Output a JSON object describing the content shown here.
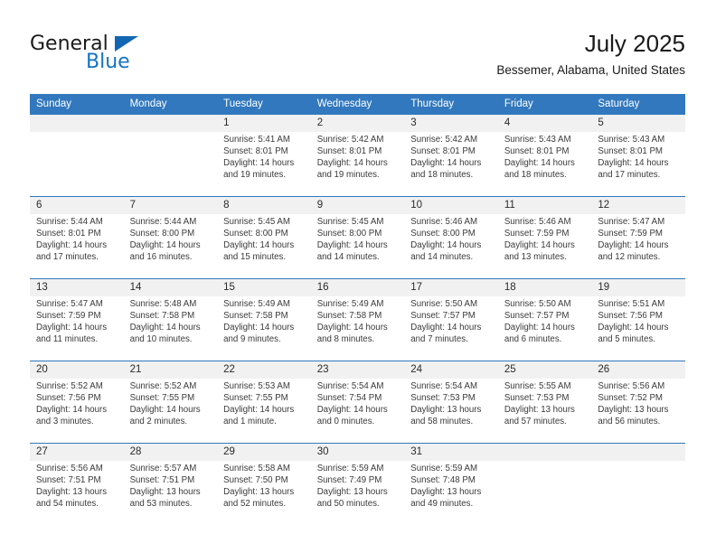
{
  "brand": {
    "name_part1": "General",
    "name_part2": "Blue",
    "triangle_icon": "triangle-icon",
    "accent_color": "#1573c6",
    "triangle_color": "#1267b2"
  },
  "header": {
    "title": "July 2025",
    "subtitle": "Bessemer, Alabama, United States"
  },
  "theme": {
    "header_bg": "#3278be",
    "header_text": "#ffffff",
    "daynum_bg": "#f1f1f1",
    "row_border": "#3278be",
    "body_text": "#3a3a3a"
  },
  "weekday_headers": [
    "Sunday",
    "Monday",
    "Tuesday",
    "Wednesday",
    "Thursday",
    "Friday",
    "Saturday"
  ],
  "labels": {
    "sunrise_prefix": "Sunrise:",
    "sunset_prefix": "Sunset:",
    "daylight_prefix": "Daylight:"
  },
  "weeks": [
    [
      {
        "day": "",
        "sunrise": "",
        "sunset": "",
        "daylight_line1": "",
        "daylight_line2": ""
      },
      {
        "day": "",
        "sunrise": "",
        "sunset": "",
        "daylight_line1": "",
        "daylight_line2": ""
      },
      {
        "day": "1",
        "sunrise": "Sunrise: 5:41 AM",
        "sunset": "Sunset: 8:01 PM",
        "daylight_line1": "Daylight: 14 hours",
        "daylight_line2": "and 19 minutes."
      },
      {
        "day": "2",
        "sunrise": "Sunrise: 5:42 AM",
        "sunset": "Sunset: 8:01 PM",
        "daylight_line1": "Daylight: 14 hours",
        "daylight_line2": "and 19 minutes."
      },
      {
        "day": "3",
        "sunrise": "Sunrise: 5:42 AM",
        "sunset": "Sunset: 8:01 PM",
        "daylight_line1": "Daylight: 14 hours",
        "daylight_line2": "and 18 minutes."
      },
      {
        "day": "4",
        "sunrise": "Sunrise: 5:43 AM",
        "sunset": "Sunset: 8:01 PM",
        "daylight_line1": "Daylight: 14 hours",
        "daylight_line2": "and 18 minutes."
      },
      {
        "day": "5",
        "sunrise": "Sunrise: 5:43 AM",
        "sunset": "Sunset: 8:01 PM",
        "daylight_line1": "Daylight: 14 hours",
        "daylight_line2": "and 17 minutes."
      }
    ],
    [
      {
        "day": "6",
        "sunrise": "Sunrise: 5:44 AM",
        "sunset": "Sunset: 8:01 PM",
        "daylight_line1": "Daylight: 14 hours",
        "daylight_line2": "and 17 minutes."
      },
      {
        "day": "7",
        "sunrise": "Sunrise: 5:44 AM",
        "sunset": "Sunset: 8:00 PM",
        "daylight_line1": "Daylight: 14 hours",
        "daylight_line2": "and 16 minutes."
      },
      {
        "day": "8",
        "sunrise": "Sunrise: 5:45 AM",
        "sunset": "Sunset: 8:00 PM",
        "daylight_line1": "Daylight: 14 hours",
        "daylight_line2": "and 15 minutes."
      },
      {
        "day": "9",
        "sunrise": "Sunrise: 5:45 AM",
        "sunset": "Sunset: 8:00 PM",
        "daylight_line1": "Daylight: 14 hours",
        "daylight_line2": "and 14 minutes."
      },
      {
        "day": "10",
        "sunrise": "Sunrise: 5:46 AM",
        "sunset": "Sunset: 8:00 PM",
        "daylight_line1": "Daylight: 14 hours",
        "daylight_line2": "and 14 minutes."
      },
      {
        "day": "11",
        "sunrise": "Sunrise: 5:46 AM",
        "sunset": "Sunset: 7:59 PM",
        "daylight_line1": "Daylight: 14 hours",
        "daylight_line2": "and 13 minutes."
      },
      {
        "day": "12",
        "sunrise": "Sunrise: 5:47 AM",
        "sunset": "Sunset: 7:59 PM",
        "daylight_line1": "Daylight: 14 hours",
        "daylight_line2": "and 12 minutes."
      }
    ],
    [
      {
        "day": "13",
        "sunrise": "Sunrise: 5:47 AM",
        "sunset": "Sunset: 7:59 PM",
        "daylight_line1": "Daylight: 14 hours",
        "daylight_line2": "and 11 minutes."
      },
      {
        "day": "14",
        "sunrise": "Sunrise: 5:48 AM",
        "sunset": "Sunset: 7:58 PM",
        "daylight_line1": "Daylight: 14 hours",
        "daylight_line2": "and 10 minutes."
      },
      {
        "day": "15",
        "sunrise": "Sunrise: 5:49 AM",
        "sunset": "Sunset: 7:58 PM",
        "daylight_line1": "Daylight: 14 hours",
        "daylight_line2": "and 9 minutes."
      },
      {
        "day": "16",
        "sunrise": "Sunrise: 5:49 AM",
        "sunset": "Sunset: 7:58 PM",
        "daylight_line1": "Daylight: 14 hours",
        "daylight_line2": "and 8 minutes."
      },
      {
        "day": "17",
        "sunrise": "Sunrise: 5:50 AM",
        "sunset": "Sunset: 7:57 PM",
        "daylight_line1": "Daylight: 14 hours",
        "daylight_line2": "and 7 minutes."
      },
      {
        "day": "18",
        "sunrise": "Sunrise: 5:50 AM",
        "sunset": "Sunset: 7:57 PM",
        "daylight_line1": "Daylight: 14 hours",
        "daylight_line2": "and 6 minutes."
      },
      {
        "day": "19",
        "sunrise": "Sunrise: 5:51 AM",
        "sunset": "Sunset: 7:56 PM",
        "daylight_line1": "Daylight: 14 hours",
        "daylight_line2": "and 5 minutes."
      }
    ],
    [
      {
        "day": "20",
        "sunrise": "Sunrise: 5:52 AM",
        "sunset": "Sunset: 7:56 PM",
        "daylight_line1": "Daylight: 14 hours",
        "daylight_line2": "and 3 minutes."
      },
      {
        "day": "21",
        "sunrise": "Sunrise: 5:52 AM",
        "sunset": "Sunset: 7:55 PM",
        "daylight_line1": "Daylight: 14 hours",
        "daylight_line2": "and 2 minutes."
      },
      {
        "day": "22",
        "sunrise": "Sunrise: 5:53 AM",
        "sunset": "Sunset: 7:55 PM",
        "daylight_line1": "Daylight: 14 hours",
        "daylight_line2": "and 1 minute."
      },
      {
        "day": "23",
        "sunrise": "Sunrise: 5:54 AM",
        "sunset": "Sunset: 7:54 PM",
        "daylight_line1": "Daylight: 14 hours",
        "daylight_line2": "and 0 minutes."
      },
      {
        "day": "24",
        "sunrise": "Sunrise: 5:54 AM",
        "sunset": "Sunset: 7:53 PM",
        "daylight_line1": "Daylight: 13 hours",
        "daylight_line2": "and 58 minutes."
      },
      {
        "day": "25",
        "sunrise": "Sunrise: 5:55 AM",
        "sunset": "Sunset: 7:53 PM",
        "daylight_line1": "Daylight: 13 hours",
        "daylight_line2": "and 57 minutes."
      },
      {
        "day": "26",
        "sunrise": "Sunrise: 5:56 AM",
        "sunset": "Sunset: 7:52 PM",
        "daylight_line1": "Daylight: 13 hours",
        "daylight_line2": "and 56 minutes."
      }
    ],
    [
      {
        "day": "27",
        "sunrise": "Sunrise: 5:56 AM",
        "sunset": "Sunset: 7:51 PM",
        "daylight_line1": "Daylight: 13 hours",
        "daylight_line2": "and 54 minutes."
      },
      {
        "day": "28",
        "sunrise": "Sunrise: 5:57 AM",
        "sunset": "Sunset: 7:51 PM",
        "daylight_line1": "Daylight: 13 hours",
        "daylight_line2": "and 53 minutes."
      },
      {
        "day": "29",
        "sunrise": "Sunrise: 5:58 AM",
        "sunset": "Sunset: 7:50 PM",
        "daylight_line1": "Daylight: 13 hours",
        "daylight_line2": "and 52 minutes."
      },
      {
        "day": "30",
        "sunrise": "Sunrise: 5:59 AM",
        "sunset": "Sunset: 7:49 PM",
        "daylight_line1": "Daylight: 13 hours",
        "daylight_line2": "and 50 minutes."
      },
      {
        "day": "31",
        "sunrise": "Sunrise: 5:59 AM",
        "sunset": "Sunset: 7:48 PM",
        "daylight_line1": "Daylight: 13 hours",
        "daylight_line2": "and 49 minutes."
      },
      {
        "day": "",
        "sunrise": "",
        "sunset": "",
        "daylight_line1": "",
        "daylight_line2": ""
      },
      {
        "day": "",
        "sunrise": "",
        "sunset": "",
        "daylight_line1": "",
        "daylight_line2": ""
      }
    ]
  ]
}
